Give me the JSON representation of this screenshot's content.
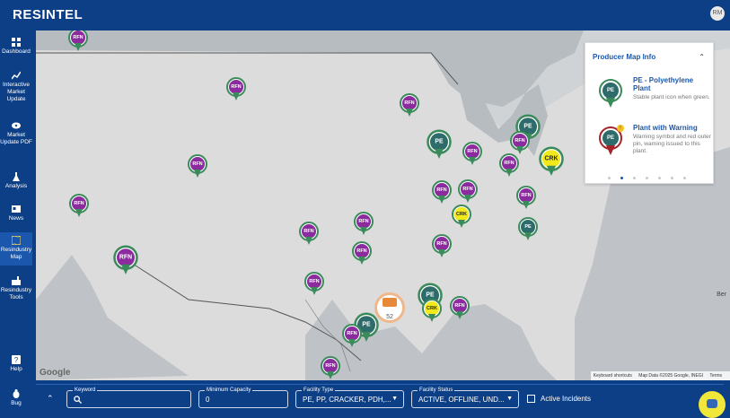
{
  "app": {
    "logo": "RESINTEL",
    "user_initials": "RM"
  },
  "sidebar": {
    "items": [
      {
        "label": "Dashboard",
        "icon": "dashboard-icon"
      },
      {
        "label": "Interactive Market Update",
        "icon": "chart-line-icon"
      },
      {
        "label": "Market Update PDF",
        "icon": "cloud-download-icon"
      },
      {
        "label": "Analysis",
        "icon": "flask-icon"
      },
      {
        "label": "News",
        "icon": "news-icon"
      },
      {
        "label": "Resindustry Map",
        "icon": "map-icon"
      },
      {
        "label": "Resindustry Tools",
        "icon": "tools-icon"
      },
      {
        "label": "Help",
        "icon": "help-icon"
      },
      {
        "label": "Bug",
        "icon": "bug-icon"
      }
    ]
  },
  "map": {
    "pins_text": {
      "rfn": "RFN",
      "pe": "PE",
      "crk": "CRK"
    },
    "cluster_count": "52",
    "label_ber": "Ber",
    "google": "Google",
    "footer": {
      "shortcuts": "Keyboard shortcuts",
      "data": "Map Data ©2025 Google, INEGI",
      "terms": "Terms"
    }
  },
  "info_panel": {
    "title": "Producer Map Info",
    "legend": [
      {
        "pin": "PE",
        "name": "PE - Polyethylene Plant",
        "desc": "Stable plant icon when green."
      },
      {
        "pin": "PE",
        "name": "Plant with Warning",
        "desc": "Warning symbol and red outer pin, warning issued to this plant."
      }
    ],
    "warning_symbol": "!"
  },
  "filters": {
    "keyword": {
      "label": "Keyword",
      "value": ""
    },
    "min_capacity": {
      "label": "Minimum Capacity",
      "value": "0"
    },
    "facility_type": {
      "label": "Facility Type",
      "value": "PE, PP, CRACKER, PDH,..."
    },
    "facility_status": {
      "label": "Facility Status",
      "value": "ACTIVE, OFFLINE, UND..."
    },
    "active_incidents": {
      "label": "Active Incidents"
    }
  }
}
